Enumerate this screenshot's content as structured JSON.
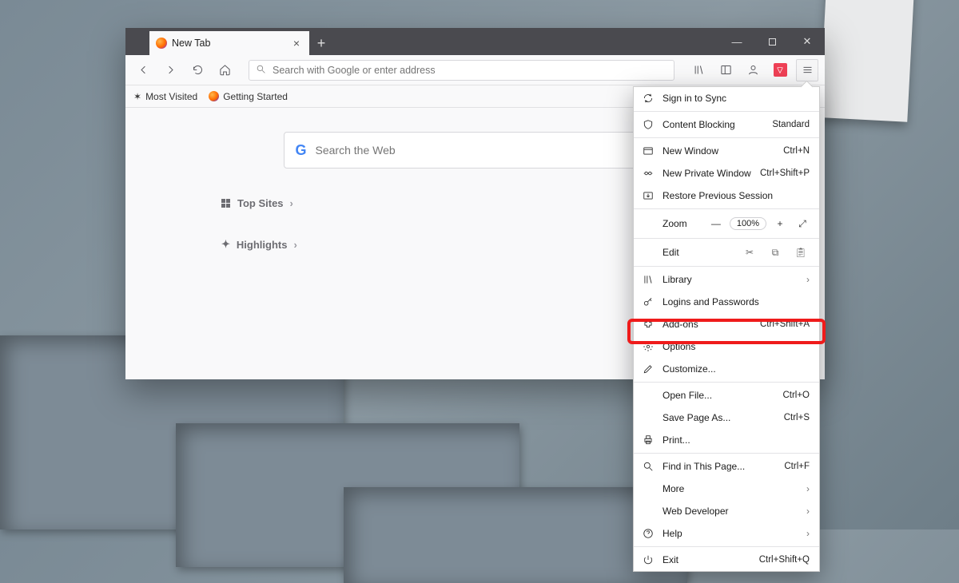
{
  "tab": {
    "title": "New Tab"
  },
  "toolbar": {
    "address_placeholder": "Search with Google or enter address"
  },
  "bookmarks": {
    "most_visited": "Most Visited",
    "getting_started": "Getting Started"
  },
  "newtab": {
    "search_placeholder": "Search the Web",
    "top_sites": "Top Sites",
    "highlights": "Highlights"
  },
  "menu": {
    "sign_in": "Sign in to Sync",
    "content_blocking": "Content Blocking",
    "content_blocking_state": "Standard",
    "new_window": "New Window",
    "new_window_sc": "Ctrl+N",
    "new_private": "New Private Window",
    "new_private_sc": "Ctrl+Shift+P",
    "restore": "Restore Previous Session",
    "zoom_label": "Zoom",
    "zoom_value": "100%",
    "edit_label": "Edit",
    "library": "Library",
    "logins": "Logins and Passwords",
    "addons": "Add-ons",
    "addons_sc": "Ctrl+Shift+A",
    "options": "Options",
    "customize": "Customize...",
    "open_file": "Open File...",
    "open_file_sc": "Ctrl+O",
    "save_as": "Save Page As...",
    "save_as_sc": "Ctrl+S",
    "print": "Print...",
    "find": "Find in This Page...",
    "find_sc": "Ctrl+F",
    "more": "More",
    "web_dev": "Web Developer",
    "help": "Help",
    "exit": "Exit",
    "exit_sc": "Ctrl+Shift+Q"
  }
}
